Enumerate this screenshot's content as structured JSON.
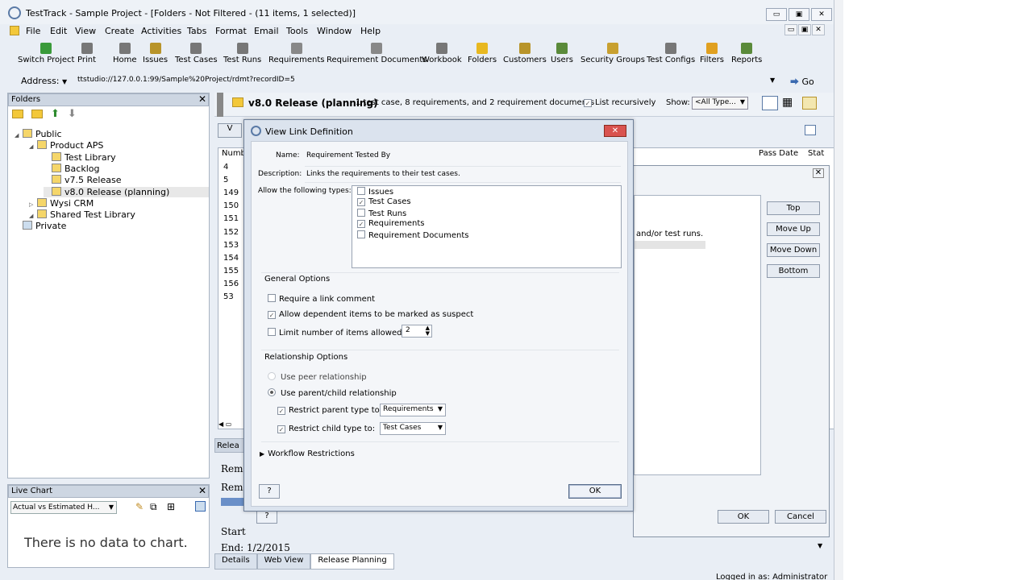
{
  "window": {
    "title": "TestTrack - Sample Project - [Folders - Not Filtered - (11 items, 1 selected)]",
    "buttons": [
      "▭",
      "▣",
      "✕"
    ]
  },
  "menu": [
    "File",
    "Edit",
    "View",
    "Create",
    "Activities",
    "Tabs",
    "Format",
    "Email",
    "Tools",
    "Window",
    "Help"
  ],
  "mdi_buttons": [
    "▭",
    "▣",
    "✕"
  ],
  "toolbar": [
    {
      "label": "Switch Project",
      "icon": "switch-project-icon",
      "color": "#3a9a3a"
    },
    {
      "label": "Print",
      "icon": "print-icon",
      "color": "#777"
    },
    {
      "label": "Home",
      "icon": "home-icon",
      "color": "#777"
    },
    {
      "label": "Issues",
      "icon": "issues-icon",
      "color": "#b8942a"
    },
    {
      "label": "Test Cases",
      "icon": "test-cases-icon",
      "color": "#777"
    },
    {
      "label": "Test Runs",
      "icon": "test-runs-icon",
      "color": "#777"
    },
    {
      "label": "Requirements",
      "icon": "requirements-icon",
      "color": "#888"
    },
    {
      "label": "Requirement Documents",
      "icon": "requirement-documents-icon",
      "color": "#888"
    },
    {
      "label": "Workbook",
      "icon": "workbook-icon",
      "color": "#777"
    },
    {
      "label": "Folders",
      "icon": "folders-icon",
      "color": "#e8b820"
    },
    {
      "label": "Customers",
      "icon": "customers-icon",
      "color": "#b8942a"
    },
    {
      "label": "Users",
      "icon": "users-icon",
      "color": "#5a8a3a"
    },
    {
      "label": "Security Groups",
      "icon": "security-groups-icon",
      "color": "#c8a030"
    },
    {
      "label": "Test Configs",
      "icon": "test-configs-icon",
      "color": "#777"
    },
    {
      "label": "Filters",
      "icon": "filters-icon",
      "color": "#e0a020"
    },
    {
      "label": "Reports",
      "icon": "reports-icon",
      "color": "#5a8a3a"
    }
  ],
  "address": {
    "label": "Address:",
    "value": "ttstudio://127.0.0.1:99/Sample%20Project/rdmt?recordID=5",
    "go": "Go"
  },
  "folders_panel": {
    "title": "Folders",
    "close": "✕",
    "tree": [
      {
        "label": "Public",
        "indent": 0
      },
      {
        "label": "Product APS",
        "indent": 1
      },
      {
        "label": "Test Library",
        "indent": 2
      },
      {
        "label": "Backlog",
        "indent": 2
      },
      {
        "label": "v7.5 Release",
        "indent": 2
      },
      {
        "label": "v8.0 Release (planning)",
        "indent": 2,
        "selected": true
      },
      {
        "label": "Wysi CRM",
        "indent": 1
      },
      {
        "label": "Shared Test Library",
        "indent": 1
      },
      {
        "label": "Private",
        "indent": 0
      }
    ]
  },
  "live_chart": {
    "title": "Live Chart",
    "close": "✕",
    "select": "Actual vs Estimated H...",
    "empty": "There is no data to chart."
  },
  "release": {
    "title": "v8.0 Release (planning)",
    "desc": "1 test case, 8 requirements, and 2 requirement documents",
    "list_recursively": "List recursively",
    "show_label": "Show:",
    "show_value": "<All Type...",
    "button_fragment": "V"
  },
  "table": {
    "col_number": "Numb",
    "col_pass_date": "Pass Date",
    "col_status": "Stat",
    "numbers": [
      "4",
      "5",
      "149",
      "150",
      "151",
      "152",
      "153",
      "154",
      "155",
      "156",
      "53"
    ]
  },
  "release_section": {
    "tab_fragment": "Relea",
    "lines": [
      "Rem",
      "Rem",
      "Start",
      "End: 1/2/2015"
    ]
  },
  "bottom_tabs": [
    "Details",
    "Web View",
    "Release Planning"
  ],
  "status": "Logged in as: Administrator",
  "bg_dialog": {
    "text_fragment": "and/or test runs.",
    "buttons": [
      "Top",
      "Move Up",
      "Move Down",
      "Bottom"
    ],
    "ok": "OK",
    "cancel": "Cancel",
    "help": "?"
  },
  "dialog": {
    "title": "View Link Definition",
    "close": "✕",
    "name_label": "Name:",
    "name_value": "Requirement Tested By",
    "desc_label": "Description:",
    "desc_value": "Links the requirements to their test cases.",
    "types_label": "Allow the following types:",
    "types": [
      {
        "label": "Issues",
        "checked": false
      },
      {
        "label": "Test Cases",
        "checked": true
      },
      {
        "label": "Test Runs",
        "checked": false
      },
      {
        "label": "Requirements",
        "checked": true
      },
      {
        "label": "Requirement Documents",
        "checked": false
      }
    ],
    "general_title": "General Options",
    "require_comment": "Require a link comment",
    "allow_suspect": "Allow dependent items to be marked as suspect",
    "limit_items": "Limit number of items allowed to:",
    "limit_value": "2",
    "relationship_title": "Relationship Options",
    "peer": "Use peer relationship",
    "parent_child": "Use parent/child relationship",
    "restrict_parent": "Restrict parent type to:",
    "restrict_parent_value": "Requirements",
    "restrict_child": "Restrict child type to:",
    "restrict_child_value": "Test Cases",
    "workflow": "Workflow Restrictions",
    "help": "?",
    "ok": "OK"
  }
}
